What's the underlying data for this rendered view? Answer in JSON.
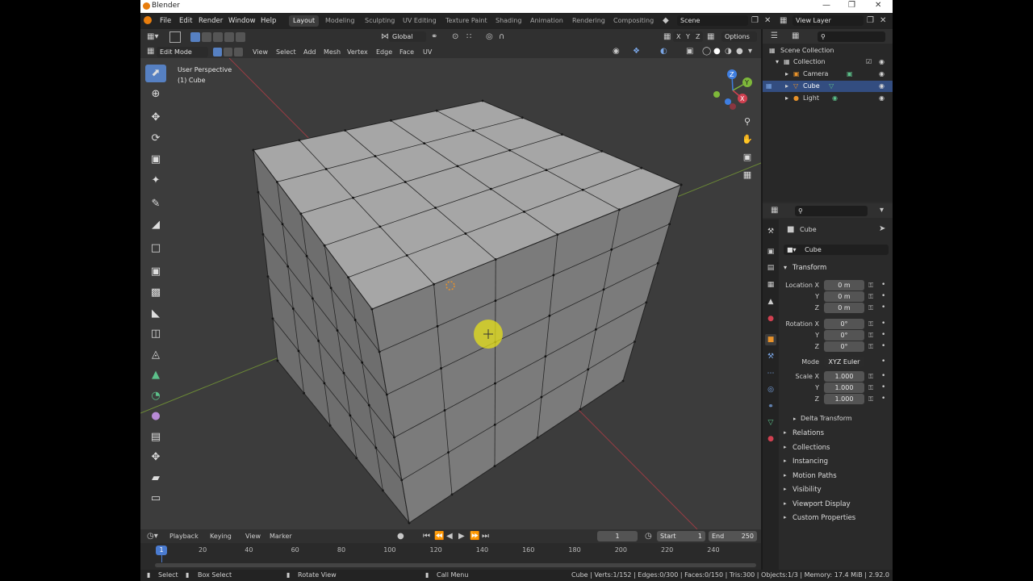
{
  "app": {
    "title": "Blender"
  },
  "menus": [
    "File",
    "Edit",
    "Render",
    "Window",
    "Help"
  ],
  "workspaces": [
    "Layout",
    "Modeling",
    "Sculpting",
    "UV Editing",
    "Texture Paint",
    "Shading",
    "Animation",
    "Rendering",
    "Compositing"
  ],
  "scene": "Scene",
  "view_layer": "View Layer",
  "header": {
    "orientation": "Global",
    "options": "Options"
  },
  "viewport_header": {
    "mode": "Edit Mode",
    "menus": [
      "View",
      "Select",
      "Add",
      "Mesh",
      "Vertex",
      "Edge",
      "Face",
      "UV"
    ]
  },
  "viewport": {
    "perspective": "User Perspective",
    "object": "(1) Cube"
  },
  "gizmo": {
    "x": "X",
    "y": "Y",
    "z": "Z"
  },
  "outliner": {
    "items": [
      {
        "label": "Scene Collection"
      },
      {
        "label": "Collection"
      },
      {
        "label": "Camera"
      },
      {
        "label": "Cube"
      },
      {
        "label": "Light"
      }
    ]
  },
  "properties": {
    "context": "Cube",
    "object_name": "Cube",
    "transform": "Transform",
    "location_label": "Location X",
    "rotation_label": "Rotation X",
    "scale_label": "Scale X",
    "y": "Y",
    "z": "Z",
    "loc": [
      "0 m",
      "0 m",
      "0 m"
    ],
    "rot": [
      "0°",
      "0°",
      "0°"
    ],
    "mode_label": "Mode",
    "mode": "XYZ Euler",
    "scale": [
      "1.000",
      "1.000",
      "1.000"
    ],
    "delta": "Delta Transform",
    "sections": [
      "Relations",
      "Collections",
      "Instancing",
      "Motion Paths",
      "Visibility",
      "Viewport Display",
      "Custom Properties"
    ]
  },
  "timeline": {
    "menus": [
      "Playback",
      "Keying",
      "View",
      "Marker"
    ],
    "current_frame": "1",
    "start_label": "Start",
    "start": "1",
    "end_label": "End",
    "end": "250",
    "ticks": [
      "20",
      "40",
      "60",
      "80",
      "100",
      "120",
      "140",
      "160",
      "180",
      "200",
      "220",
      "240"
    ]
  },
  "status": {
    "select": "Select",
    "box_select": "Box Select",
    "rotate_view": "Rotate View",
    "call_menu": "Call Menu",
    "stats": "Cube | Verts:1/152 | Edges:0/300 | Faces:0/150 | Tris:300 | Objects:1/3 | Memory: 17.4 MiB | 2.92.0"
  },
  "colors": {
    "accent": "#5680c2",
    "active_row": "#334d80",
    "x_axis": "#d04050",
    "y_axis": "#7eb83a",
    "z_axis": "#3f7ee0"
  }
}
